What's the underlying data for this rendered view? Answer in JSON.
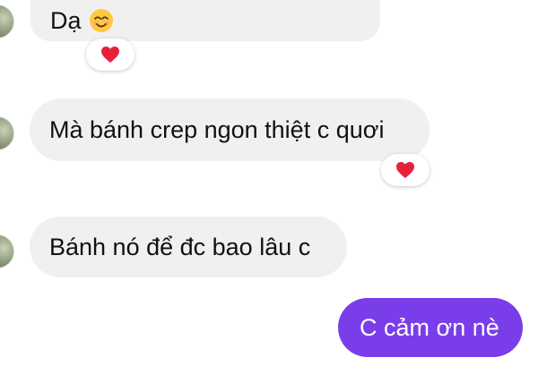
{
  "colors": {
    "incoming_bubble": "#f0f0f0",
    "outgoing_bubble": "#7a3dea",
    "reaction_heart": "#e8213a",
    "text": "#111111"
  },
  "conversation": {
    "messages": [
      {
        "direction": "incoming",
        "text": "Dạ",
        "emoji": "smiling-face-icon",
        "reaction": "heart-icon"
      },
      {
        "direction": "incoming",
        "text": "Mà bánh crep ngon thiệt c quơi",
        "reaction": "heart-icon"
      },
      {
        "direction": "incoming",
        "text": "Bánh nó để đc bao lâu c"
      },
      {
        "direction": "outgoing",
        "text": "C cảm ơn nè"
      }
    ]
  }
}
